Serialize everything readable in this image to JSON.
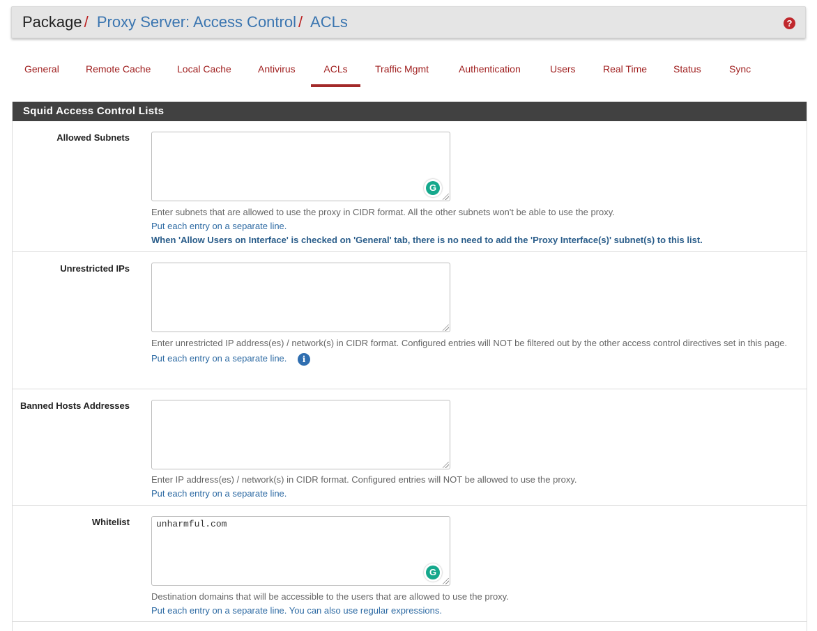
{
  "breadcrumb": {
    "root": "Package",
    "items": [
      "Proxy Server: Access Control",
      "ACLs"
    ],
    "separator": "/"
  },
  "help_icon": "question-circle-icon",
  "tabs": [
    {
      "label": "General",
      "active": false
    },
    {
      "label": "Remote Cache",
      "active": false
    },
    {
      "label": "Local Cache",
      "active": false
    },
    {
      "label": "Antivirus",
      "active": false
    },
    {
      "label": "ACLs",
      "active": true
    },
    {
      "label": "Traffic Mgmt",
      "active": false
    },
    {
      "label": "Authentication",
      "active": false
    },
    {
      "label": "Users",
      "active": false
    },
    {
      "label": "Real Time",
      "active": false
    },
    {
      "label": "Status",
      "active": false
    },
    {
      "label": "Sync",
      "active": false
    }
  ],
  "panel": {
    "title": "Squid Access Control Lists",
    "fields": [
      {
        "label": "Allowed Subnets",
        "value": "",
        "help": "Enter subnets that are allowed to use the proxy in CIDR format. All the other subnets won't be able to use the proxy.",
        "help_line2": "Put each entry on a separate line.",
        "help_note": "When 'Allow Users on Interface' is checked on 'General' tab, there is no need to add the 'Proxy Interface(s)' subnet(s) to this list."
      },
      {
        "label": "Unrestricted IPs",
        "value": "",
        "help": "Enter unrestricted IP address(es) / network(s) in CIDR format. Configured entries will NOT be filtered out by the other access control directives set in this page.",
        "help_line2": "Put each entry on a separate line."
      },
      {
        "label": "Banned Hosts Addresses",
        "value": "",
        "help": "Enter IP address(es) / network(s) in CIDR format. Configured entries will NOT be allowed to use the proxy.",
        "help_line2": "Put each entry on a separate line."
      },
      {
        "label": "Whitelist",
        "value": "unharmful.com",
        "help": "Destination domains that will be accessible to the users that are allowed to use the proxy.",
        "help_line2": "Put each entry on a separate line. You can also use regular expressions."
      }
    ]
  },
  "colors": {
    "accent": "#a32a2a",
    "link": "#3a75b0",
    "panel_header": "#414141",
    "grammarly": "#15a88c"
  }
}
